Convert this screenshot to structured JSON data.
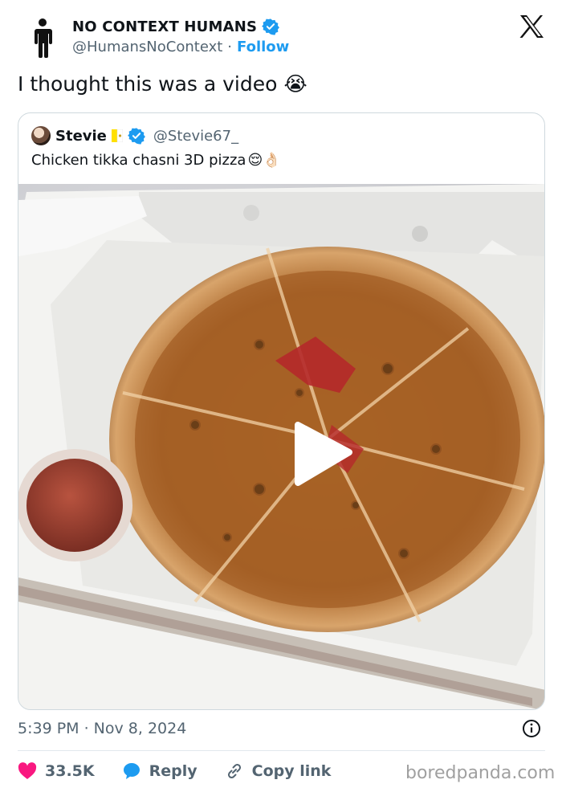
{
  "author": {
    "display_name": "NO CONTEXT HUMANS",
    "handle": "@HumansNoContext",
    "separator": "·",
    "follow_label": "Follow",
    "verified": true,
    "avatar_icon": "standing-person-icon"
  },
  "platform_logo": "x-logo-icon",
  "tweet": {
    "text": "I thought this was a video",
    "emoji": "😭"
  },
  "quoted_tweet": {
    "display_name": "Stevie",
    "handle": "@Stevie67_",
    "verified": true,
    "flag_icon": "vatican-flag-icon",
    "text": "Chicken tikka chasni 3D pizza",
    "emoji": "😌👌🏻",
    "media_description_icon": "play-button-icon"
  },
  "meta": {
    "timestamp": "5:39 PM · Nov 8, 2024"
  },
  "actions": {
    "like_count": "33.5K",
    "reply_label": "Reply",
    "copy_label": "Copy link"
  },
  "watermark": "boredpanda.com",
  "colors": {
    "link_blue": "#1d9bf0",
    "like_pink": "#f91880",
    "secondary_text": "#536471",
    "border": "#cfd9de"
  }
}
